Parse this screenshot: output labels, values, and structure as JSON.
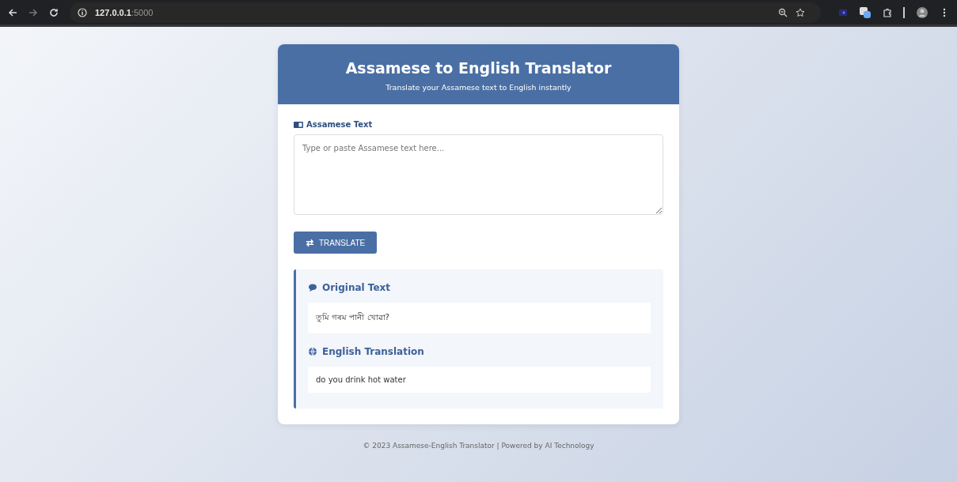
{
  "browser": {
    "url_host": "127.0.0.1",
    "url_port": ":5000"
  },
  "header": {
    "title": "Assamese to English Translator",
    "subtitle": "Translate your Assamese text to English instantly"
  },
  "input": {
    "label": "Assamese Text",
    "placeholder": "Type or paste Assamese text here..."
  },
  "translate_button": "TRANSLATE",
  "result": {
    "original_label": "Original Text",
    "original_text": "তুমি গৰম পানী খোৱা?",
    "translation_label": "English Translation",
    "translation_text": "do you drink hot water"
  },
  "footer": "© 2023 Assamese-English Translator | Powered by AI Technology"
}
